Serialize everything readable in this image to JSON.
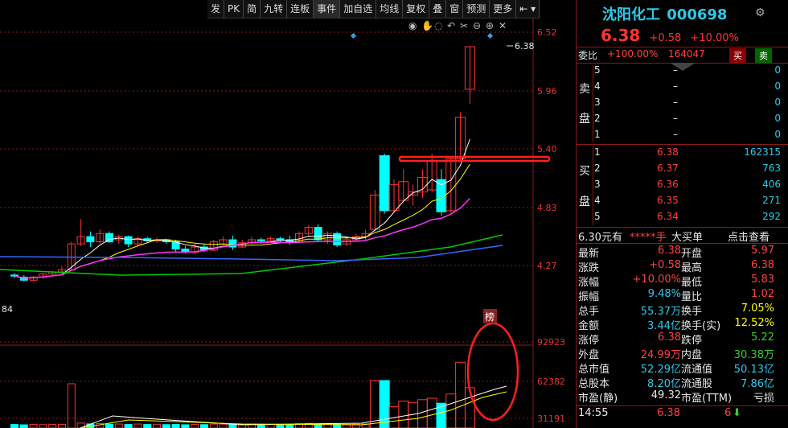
{
  "toolbar": [
    "发",
    "PK",
    "简",
    "九转",
    "连板",
    "事件",
    "加自选",
    "均线",
    "复权",
    "叠",
    "窗",
    "预测",
    "更多"
  ],
  "chart": {
    "y_labels": [
      "6.52",
      "5.96",
      "5.40",
      "4.83",
      "4.27"
    ],
    "vol_labels": [
      "92923",
      "62382",
      "31191"
    ],
    "last_price_tag": "6.38",
    "low_tag": "84",
    "badge": "榜",
    "colors": {
      "up": "#ff3333",
      "down": "#00ffff",
      "ma5": "#ffffff",
      "ma10": "#ffff00",
      "ma20": "#ff33ff",
      "ma60": "#00cc00",
      "ma120": "#3366ff"
    }
  },
  "stock": {
    "name": "沈阳化工",
    "code": "000698",
    "price": "6.38",
    "change": "+0.58",
    "change_pct": "+10.00%"
  },
  "weibi": {
    "label": "委比",
    "pct": "+100.00%",
    "diff": "164047",
    "buy": "买",
    "sell": "卖"
  },
  "sell_side": {
    "label_top": "卖",
    "label_bottom": "盘",
    "rows": [
      {
        "n": "5",
        "price": "–",
        "vol": "0"
      },
      {
        "n": "4",
        "price": "–",
        "vol": "0"
      },
      {
        "n": "3",
        "price": "–",
        "vol": "0"
      },
      {
        "n": "2",
        "price": "–",
        "vol": "0"
      },
      {
        "n": "1",
        "price": "–",
        "vol": "0"
      }
    ]
  },
  "buy_side": {
    "label_top": "买",
    "label_bottom": "盘",
    "rows": [
      {
        "n": "1",
        "price": "6.38",
        "vol": "162315"
      },
      {
        "n": "2",
        "price": "6.37",
        "vol": "763"
      },
      {
        "n": "3",
        "price": "6.36",
        "vol": "406"
      },
      {
        "n": "4",
        "price": "6.35",
        "vol": "271"
      },
      {
        "n": "5",
        "price": "6.34",
        "vol": "292"
      }
    ]
  },
  "info_bar": {
    "price": "6.30元有",
    "stars": "*****手",
    "big_buy": "大买单",
    "check": "点击查看"
  },
  "stats": [
    {
      "l1": "最新",
      "v1": "6.38",
      "c1": "red",
      "l2": "开盘",
      "v2": "5.97",
      "c2": "red"
    },
    {
      "l1": "涨跌",
      "v1": "+0.58",
      "c1": "red",
      "l2": "最高",
      "v2": "6.38",
      "c2": "red"
    },
    {
      "l1": "涨幅",
      "v1": "+10.00%",
      "c1": "red",
      "l2": "最低",
      "v2": "5.83",
      "c2": "red"
    },
    {
      "l1": "振幅",
      "v1": "9.48%",
      "c1": "cyan",
      "l2": "量比",
      "v2": "1.02",
      "c2": "red"
    },
    {
      "l1": "总手",
      "v1": "55.37万",
      "c1": "cyan",
      "l2": "换手",
      "v2": "7.05%",
      "c2": "yellow"
    },
    {
      "l1": "金额",
      "v1": "3.44亿",
      "c1": "cyan",
      "l2": "换手(实)",
      "v2": "12.52%",
      "c2": "yellow"
    },
    {
      "l1": "涨停",
      "v1": "6.38",
      "c1": "red",
      "l2": "跌停",
      "v2": "5.22",
      "c2": "green"
    },
    {
      "l1": "外盘",
      "v1": "24.99万",
      "c1": "red",
      "l2": "内盘",
      "v2": "30.38万",
      "c2": "green"
    },
    {
      "l1": "总市值",
      "v1": "52.29亿",
      "c1": "cyan",
      "l2": "流通值",
      "v2": "50.13亿",
      "c2": "cyan"
    },
    {
      "l1": "总股本",
      "v1": "8.20亿",
      "c1": "cyan",
      "l2": "流通股",
      "v2": "7.86亿",
      "c2": "cyan"
    },
    {
      "l1": "市盈(静)",
      "v1": "49.32",
      "c1": "white",
      "l2": "市盈(TTM)",
      "v2": "亏损",
      "c2": "white"
    }
  ],
  "tick": {
    "time": "14:55",
    "price": "6.38",
    "vol": "6"
  }
}
